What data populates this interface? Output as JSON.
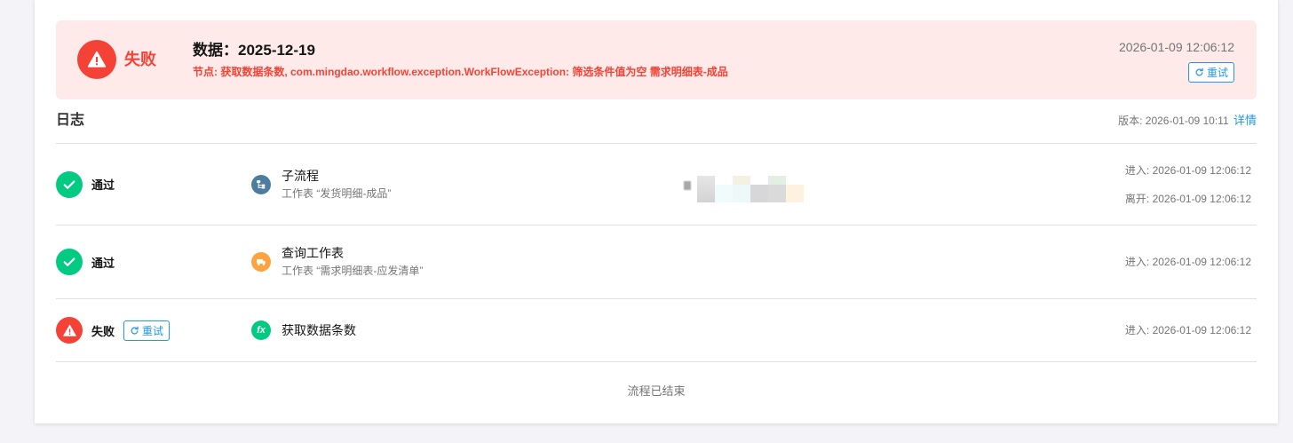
{
  "colors": {
    "accent": "#2196f3",
    "success": "#01ca83",
    "error": "#f44336",
    "banner_background": "#fdeae9",
    "subprocess_node": "#4c7d9e",
    "search_node": "#ffa340",
    "formula_node": "#01ca83",
    "text_primary": "#151515",
    "text_secondary": "#757575"
  },
  "banner": {
    "status_icon": "warning-icon",
    "status_label": "失败",
    "title": "数据：2025-12-19",
    "error_message": "节点: 获取数据条数, com.mingdao.workflow.exception.WorkFlowException: 筛选条件值为空 需求明细表-成品",
    "timestamp": "2026-01-09 12:06:12",
    "retry_icon": "refresh-icon",
    "retry_label": "重试"
  },
  "log": {
    "heading": "日志",
    "version_label": "版本:",
    "version_value": "2026-01-09 10:11",
    "details_link": "详情",
    "entries": [
      {
        "status_icon": "check-icon",
        "status_label": "通过",
        "node_icon": "subprocess-icon",
        "node_title": "子流程",
        "node_subtitle": "工作表 “发货明细-成品”",
        "enter_label": "进入:",
        "enter_time": "2026-01-09 12:06:12",
        "leave_label": "离开:",
        "leave_time": "2026-01-09 12:06:12"
      },
      {
        "status_icon": "check-icon",
        "status_label": "通过",
        "node_icon": "search-worksheet-icon",
        "node_title": "查询工作表",
        "node_subtitle": "工作表 “需求明细表-应发清单”",
        "enter_label": "进入:",
        "enter_time": "2026-01-09 12:06:12"
      },
      {
        "status_icon": "warning-icon",
        "status_label": "失败",
        "retry_icon": "refresh-icon",
        "retry_label": "重试",
        "node_icon": "formula-icon",
        "node_icon_text": "fx",
        "node_title": "获取数据条数",
        "enter_label": "进入:",
        "enter_time": "2026-01-09 12:06:12"
      }
    ],
    "footer": "流程已结束"
  }
}
